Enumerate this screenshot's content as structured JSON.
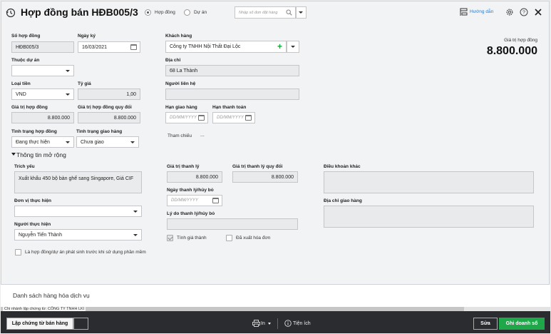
{
  "header": {
    "title": "Hợp đồng bán HĐB005/3",
    "radio_contract": "Hợp đồng",
    "radio_project": "Dự án",
    "search_placeholder": "Nhập số đơn đặt hàng",
    "guide": "Hướng dẫn"
  },
  "form": {
    "contract_no_label": "Số hợp đồng",
    "contract_no": "HĐB005/3",
    "sign_date_label": "Ngày ký",
    "sign_date": "16/03/2021",
    "customer_label": "Khách hàng",
    "customer": "Công ty TNHH Nội Thất Đại Lộc",
    "project_label": "Thuộc dự án",
    "address_label": "Địa chỉ",
    "address": "68 La Thành",
    "currency_label": "Loại tiền",
    "currency": "VND",
    "rate_label": "Tỷ giá",
    "rate": "1,00",
    "contact_label": "Người liên hệ",
    "value_label": "Giá trị hợp đồng",
    "value": "8.800.000",
    "value_conv_label": "Giá trị hợp đồng quy đổi",
    "value_conv": "8.800.000",
    "delivery_deadline_label": "Hạn giao hàng",
    "payment_deadline_label": "Hạn thanh toán",
    "date_placeholder": "DD/MM/YYYY",
    "status_label": "Tình trạng hợp đồng",
    "status": "Đang thực hiện",
    "delivery_status_label": "Tình trạng giao hàng",
    "delivery_status": "Chưa giao",
    "reference": "Tham chiếu",
    "reference_more": "...",
    "total_label": "Giá trị hợp đồng",
    "total": "8.800.000"
  },
  "more": {
    "toggle": "Thông tin mở rộng",
    "summary_label": "Trích yếu",
    "summary": "Xuất khẩu 450 bộ bàn ghế sang Singapore, Giá CIF",
    "liq_value_label": "Giá trị thanh lý",
    "liq_value": "8.800.000",
    "liq_value_conv_label": "Giá trị thanh lý quy đổi",
    "liq_value_conv": "8.800.000",
    "other_terms_label": "Điều khoản khác",
    "unit_label": "Đơn vị thực hiện",
    "liq_date_label": "Ngày thanh lý/hủy bỏ",
    "delivery_addr_label": "Địa chỉ giao hàng",
    "liq_reason_label": "Lý do thanh lý/hủy bỏ",
    "performer_label": "Người thực hiện",
    "performer": "Nguyễn Tiến Thành",
    "calc_cost": "Tính giá thành",
    "invoiced": "Đã xuất hóa đơn",
    "pre_use": "Là hợp đồng/dự án phát sinh trước khi sử dụng phần mềm"
  },
  "goods": {
    "title": "Danh sách hàng hóa dịch vụ",
    "branch": "Chi nhánh lập chứng từ: CÔNG TY TNHH LKI"
  },
  "footer": {
    "create_voucher": "Lập chứng từ bán hàng",
    "print": "In",
    "utility": "Tiện ích",
    "edit": "Sửa",
    "save": "Ghi doanh số"
  },
  "colors": {
    "accent": "#1f7bd6",
    "save_green": "#1fa84a",
    "plus_green": "#19a33b"
  }
}
